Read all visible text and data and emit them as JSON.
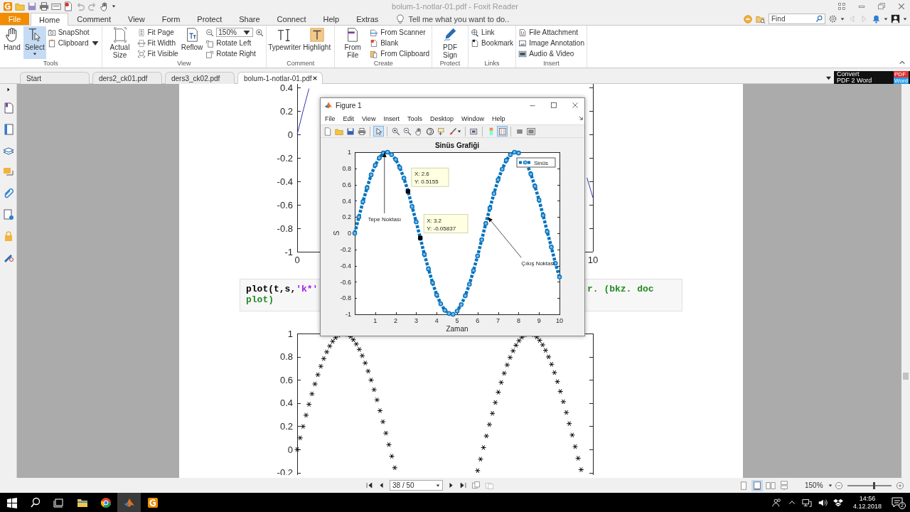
{
  "window": {
    "title": "bolum-1-notlar-01.pdf - Foxit Reader"
  },
  "ribbon_tabs": [
    {
      "label": "File",
      "kind": "file",
      "selected": false
    },
    {
      "label": "Home",
      "kind": "tab",
      "selected": true
    },
    {
      "label": "Comment",
      "kind": "tab",
      "selected": false
    },
    {
      "label": "View",
      "kind": "tab",
      "selected": false
    },
    {
      "label": "Form",
      "kind": "tab",
      "selected": false
    },
    {
      "label": "Protect",
      "kind": "tab",
      "selected": false
    },
    {
      "label": "Share",
      "kind": "tab",
      "selected": false
    },
    {
      "label": "Connect",
      "kind": "tab",
      "selected": false
    },
    {
      "label": "Help",
      "kind": "tab",
      "selected": false
    },
    {
      "label": "Extras",
      "kind": "tab",
      "selected": false
    }
  ],
  "tell_me": {
    "placeholder": "Tell me what you want to do.."
  },
  "find_field": {
    "placeholder": "Find"
  },
  "ribbon_groups": [
    {
      "label": "Tools",
      "items": [
        {
          "kind": "large",
          "label": "Hand",
          "selected": false
        },
        {
          "kind": "large",
          "label": "Select",
          "selected": true,
          "dropdown": true
        },
        {
          "kind": "stack",
          "items": [
            {
              "kind": "button",
              "label": "SnapShot"
            },
            {
              "kind": "button",
              "label": "Clipboard",
              "dropdown": true
            }
          ]
        }
      ]
    },
    {
      "label": "View",
      "items": [
        {
          "kind": "large",
          "label": "Actual Size",
          "selected": false
        },
        {
          "kind": "stack",
          "items": [
            {
              "kind": "button",
              "label": "Fit Page"
            },
            {
              "kind": "button",
              "label": "Fit Width"
            },
            {
              "kind": "button",
              "label": "Fit Visible"
            }
          ]
        },
        {
          "kind": "large",
          "label": "Reflow",
          "selected": false
        },
        {
          "kind": "stack",
          "items": [
            {
              "kind": "zoom",
              "value": "150%"
            },
            {
              "kind": "button",
              "label": "Rotate Left"
            },
            {
              "kind": "button",
              "label": "Rotate Right"
            }
          ]
        }
      ]
    },
    {
      "label": "Comment",
      "items": [
        {
          "kind": "large",
          "label": "Typewriter",
          "selected": false
        },
        {
          "kind": "large",
          "label": "Highlight",
          "selected": false
        }
      ]
    },
    {
      "label": "Create",
      "items": [
        {
          "kind": "large",
          "label": "From File",
          "selected": false
        },
        {
          "kind": "stack",
          "items": [
            {
              "kind": "button",
              "label": "From Scanner"
            },
            {
              "kind": "button",
              "label": "Blank"
            },
            {
              "kind": "button",
              "label": "From Clipboard"
            }
          ]
        }
      ]
    },
    {
      "label": "Protect",
      "items": [
        {
          "kind": "large",
          "label": "PDF Sign",
          "selected": false
        }
      ]
    },
    {
      "label": "Links",
      "items": [
        {
          "kind": "stack",
          "items": [
            {
              "kind": "button",
              "label": "Link"
            },
            {
              "kind": "button",
              "label": "Bookmark"
            }
          ]
        }
      ]
    },
    {
      "label": "Insert",
      "items": [
        {
          "kind": "stack",
          "items": [
            {
              "kind": "button",
              "label": "File Attachment"
            },
            {
              "kind": "button",
              "label": "Image Annotation"
            },
            {
              "kind": "button",
              "label": "Audio & Video"
            }
          ]
        }
      ]
    }
  ],
  "document_tabs": [
    {
      "label": "Start",
      "selected": false,
      "closable": false
    },
    {
      "label": "ders2_ck01.pdf",
      "selected": false,
      "closable": false
    },
    {
      "label": "ders3_ck02.pdf",
      "selected": false,
      "closable": false
    },
    {
      "label": "bolum-1-notlar-01.pdf",
      "selected": true,
      "closable": true
    }
  ],
  "convert_ad": {
    "line_1": "Convert",
    "line_2": "PDF 2 Word",
    "badge_top": "PDF",
    "badge_bottom": "Word"
  },
  "page": {
    "top_chart": {
      "chart_data": {
        "type": "line",
        "xlim": [
          0,
          10
        ],
        "ylim": [
          -1,
          0.43
        ],
        "xticks": [
          0,
          10
        ],
        "yticks": [
          -1,
          -0.8,
          -0.6,
          -0.4,
          -0.2,
          0,
          0.2,
          0.4
        ],
        "x": [
          0,
          0.2,
          0.4,
          0.6,
          0.8,
          1,
          1.2,
          1.4,
          1.6,
          1.8,
          2,
          2.2,
          2.4,
          2.6,
          2.8,
          3,
          3.2,
          3.4,
          3.6,
          3.8,
          4,
          4.2,
          4.4,
          4.6,
          4.8,
          5,
          5.2,
          5.4,
          5.6,
          5.8,
          6,
          6.2,
          6.4,
          6.6,
          6.8,
          7,
          7.2,
          7.4,
          7.6,
          7.8,
          8,
          8.2,
          8.4,
          8.6,
          8.8,
          9,
          9.2,
          9.4,
          9.6,
          9.8,
          10
        ],
        "series": [
          {
            "color": "#3535b0",
            "values": [
              0,
              0.2,
              0.39,
              null,
              null,
              null,
              null,
              null,
              null,
              null,
              null,
              null,
              null,
              null,
              null,
              null,
              null,
              null,
              null,
              null,
              null,
              null,
              null,
              null,
              null,
              null,
              null,
              null,
              null,
              null,
              null,
              null,
              null,
              null,
              null,
              null,
              null,
              null,
              null,
              null,
              null,
              null,
              null,
              null,
              null,
              null,
              null,
              null,
              null,
              -0.37,
              -0.54
            ]
          }
        ]
      }
    },
    "code_box": {
      "lines": [
        {
          "left": [
            {
              "kind": "code",
              "text": "plot(t,s,"
            },
            {
              "kind": "string",
              "text": "'k*'"
            }
          ],
          "right": [
            {
              "kind": "comment",
              "text": "r. (bkz. doc"
            }
          ]
        },
        {
          "left": [
            {
              "kind": "comment",
              "text": "plot)"
            }
          ]
        }
      ]
    },
    "bottom_chart": {
      "y_tick_labels": [
        "1",
        "0.8",
        "0.6",
        "0.4",
        "0.2",
        "0",
        "-0.2"
      ]
    }
  },
  "figure_window": {
    "title": "Figure 1",
    "menu": [
      "File",
      "Edit",
      "View",
      "Insert",
      "Tools",
      "Desktop",
      "Window",
      "Help"
    ],
    "toolbar": [
      {
        "kind": "button",
        "selected": false
      },
      {
        "kind": "button",
        "selected": false
      },
      {
        "kind": "button",
        "selected": false
      },
      {
        "kind": "button",
        "selected": false
      },
      {
        "kind": "separator"
      },
      {
        "kind": "button",
        "selected": true
      },
      {
        "kind": "separator"
      },
      {
        "kind": "button",
        "selected": false
      },
      {
        "kind": "button",
        "selected": false
      },
      {
        "kind": "button",
        "selected": false
      },
      {
        "kind": "button",
        "selected": false
      },
      {
        "kind": "button",
        "selected": false
      },
      {
        "kind": "button",
        "selected": false,
        "dropdown": true
      },
      {
        "kind": "separator"
      },
      {
        "kind": "button",
        "selected": false
      },
      {
        "kind": "separator"
      },
      {
        "kind": "button",
        "selected": false
      },
      {
        "kind": "button",
        "selected": true
      },
      {
        "kind": "separator"
      },
      {
        "kind": "button",
        "selected": false
      },
      {
        "kind": "button",
        "selected": false
      }
    ],
    "chart_data": {
      "type": "line",
      "title": "Sinüs Grafiği",
      "xlabel": "Zaman",
      "ylabel": "S",
      "xlim": [
        0,
        10
      ],
      "ylim": [
        -1,
        1
      ],
      "xticks": [
        1,
        2,
        3,
        4,
        5,
        6,
        7,
        8,
        9,
        10
      ],
      "yticks": [
        -1,
        -0.8,
        -0.6,
        -0.4,
        -0.2,
        0,
        0.2,
        0.4,
        0.6,
        0.8,
        1
      ],
      "x": [
        0,
        0.2,
        0.4,
        0.6,
        0.8,
        1,
        1.2,
        1.4,
        1.6,
        1.8,
        2,
        2.2,
        2.4,
        2.6,
        2.8,
        3,
        3.2,
        3.4,
        3.6,
        3.8,
        4,
        4.2,
        4.4,
        4.6,
        4.8,
        5,
        5.2,
        5.4,
        5.6,
        5.8,
        6,
        6.2,
        6.4,
        6.6,
        6.8,
        7,
        7.2,
        7.4,
        7.6,
        7.8,
        8,
        8.2,
        8.4,
        8.6,
        8.8,
        9,
        9.2,
        9.4,
        9.6,
        9.8,
        10
      ],
      "series": [
        {
          "name": "Sinüs",
          "color": "#0072bd",
          "line_style": "dashed",
          "marker": "circle",
          "values": [
            0,
            0.2,
            0.39,
            0.56,
            0.72,
            0.84,
            0.93,
            0.99,
            1,
            0.97,
            0.91,
            0.81,
            0.68,
            0.52,
            0.33,
            0.14,
            -0.06,
            -0.26,
            -0.44,
            -0.61,
            -0.76,
            -0.87,
            -0.95,
            -0.99,
            -1,
            -0.96,
            -0.88,
            -0.77,
            -0.63,
            -0.46,
            -0.28,
            -0.08,
            0.12,
            0.31,
            0.49,
            0.66,
            0.79,
            0.9,
            0.97,
            1,
            0.99,
            null,
            0.86,
            0.73,
            0.58,
            0.41,
            0.22,
            0.02,
            -0.17,
            -0.37,
            -0.54
          ]
        }
      ],
      "annotations": [
        {
          "text": "Tepe Noktası",
          "x": 1.45,
          "y": 1
        },
        {
          "text": "Çıkış Noktası",
          "x": 6.5,
          "y": 0.2
        },
        {
          "text": "X: 2.6\nY: 0.5155",
          "x": 2.6,
          "y": 0.5155
        },
        {
          "text": "X: 3.2\nY: -0.05837",
          "x": 3.2,
          "y": -0.05837
        }
      ]
    }
  },
  "status_bar": {
    "page_field": "38 / 50",
    "view_modes": [
      {
        "selected": false
      },
      {
        "selected": true
      },
      {
        "selected": false
      },
      {
        "selected": false
      }
    ],
    "zoom": "150%",
    "zoom_slider": {
      "level": 0.6
    }
  },
  "taskbar": {
    "items": [
      {
        "selected": false
      },
      {
        "selected": false
      },
      {
        "selected": false
      },
      {
        "selected": false
      },
      {
        "selected": false
      },
      {
        "selected": true
      },
      {
        "selected": false
      }
    ],
    "time": "14:56",
    "date": "4.12.2018",
    "notification_count": "2"
  }
}
